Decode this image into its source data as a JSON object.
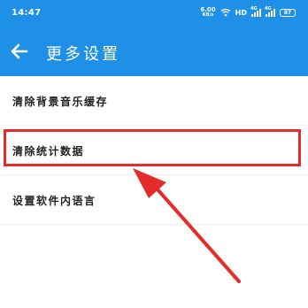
{
  "status_bar": {
    "time": "14:47",
    "net_speed": "6.00",
    "net_unit": "KB/s",
    "hd_label": "HD",
    "signal_tag": "4G",
    "battery": "87"
  },
  "app_bar": {
    "title": "更多设置",
    "back_icon": "arrow-left-icon"
  },
  "settings": {
    "items": [
      {
        "label": "清除背景音乐缓存"
      },
      {
        "label": "清除统计数据"
      },
      {
        "label": "设置软件内语言"
      }
    ],
    "highlighted_index": 1
  },
  "colors": {
    "primary": "#1e90e8",
    "highlight": "#e62b2b",
    "text": "#222222"
  }
}
